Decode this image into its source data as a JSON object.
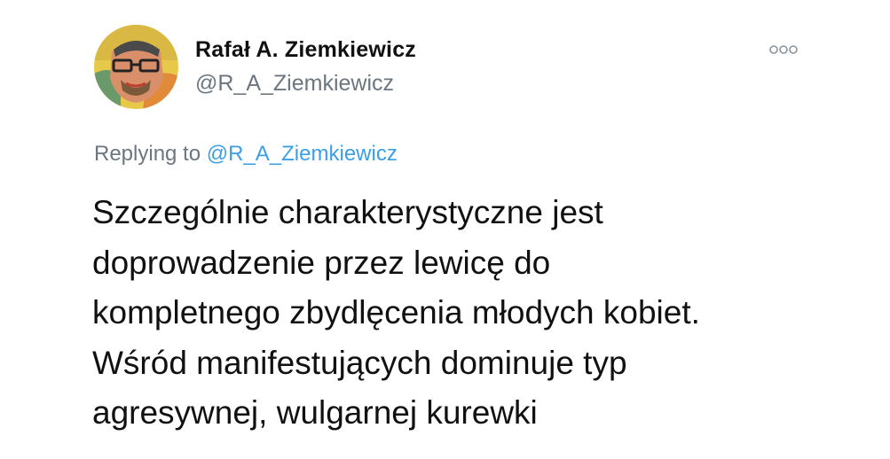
{
  "tweet": {
    "author": {
      "display_name": "Rafał A. Ziemkiewicz",
      "handle": "@R_A_Ziemkiewicz",
      "avatar_icon": "profile-avatar"
    },
    "more_icon": "more-options-icon",
    "reply": {
      "prefix": "Replying to",
      "handle": "@R_A_Ziemkiewicz"
    },
    "text_lines": [
      "Szczególnie charakterystyczne jest",
      "doprowadzenie przez lewicę do",
      "kompletnego zbydlęcenia młodych kobiet.",
      "Wśród manifestujących dominuje typ",
      "agresywnej, wulgarnej kurewki"
    ]
  },
  "colors": {
    "text": "#111111",
    "secondary": "#6b7680",
    "link": "#3c9fe6",
    "background": "#ffffff"
  }
}
